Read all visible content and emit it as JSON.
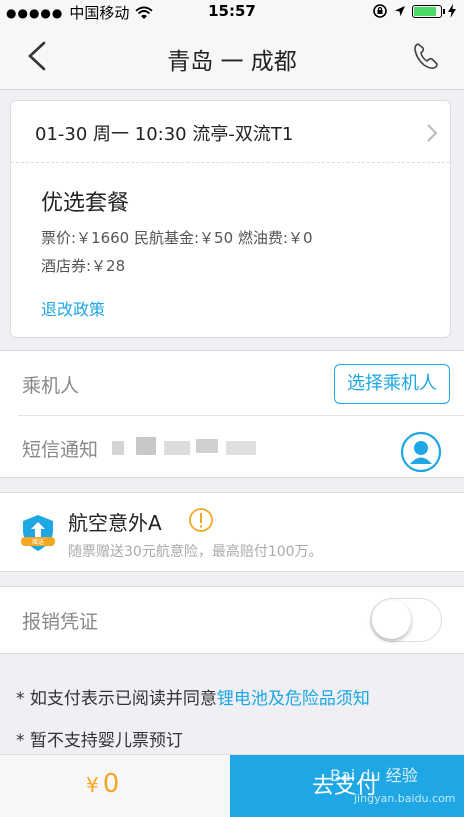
{
  "status_bar": {
    "signal_dots": "●●●●●",
    "carrier": "中国移动",
    "time": "15:57",
    "battery_level": 0.85
  },
  "nav": {
    "title": "青岛 一 成都",
    "back_icon": "chevron-left-icon",
    "phone_icon": "phone-icon"
  },
  "flight": {
    "info": "01-30 周一 10:30 流亭-双流T1",
    "package_title": "优选套餐",
    "price_line1": "票价:￥1660    民航基金:￥50    燃油费:￥0",
    "price_line2": "酒店券:￥28",
    "refund_policy": "退改政策"
  },
  "passenger": {
    "label": "乘机人",
    "select_button": "选择乘机人"
  },
  "sms": {
    "label": "短信通知"
  },
  "insurance": {
    "title": "航空意外A",
    "desc": "随票赠送30元航意险，最高赔付100万。"
  },
  "invoice": {
    "label": "报销凭证",
    "toggle_on": false
  },
  "notices": [
    {
      "text": "* 如支付表示已阅读并同意",
      "link": "锂电池及危险品须知"
    },
    {
      "text": "* 暂不支持婴儿票预订",
      "link": ""
    }
  ],
  "footer": {
    "currency": "¥",
    "total": "0",
    "pay_button": "去支付"
  },
  "watermark": {
    "brand": "Bai du 经验",
    "url": "jingyan.baidu.com"
  },
  "colors": {
    "accent": "#1ea7e4",
    "price": "#f5a623",
    "battery": "#4cd964"
  }
}
